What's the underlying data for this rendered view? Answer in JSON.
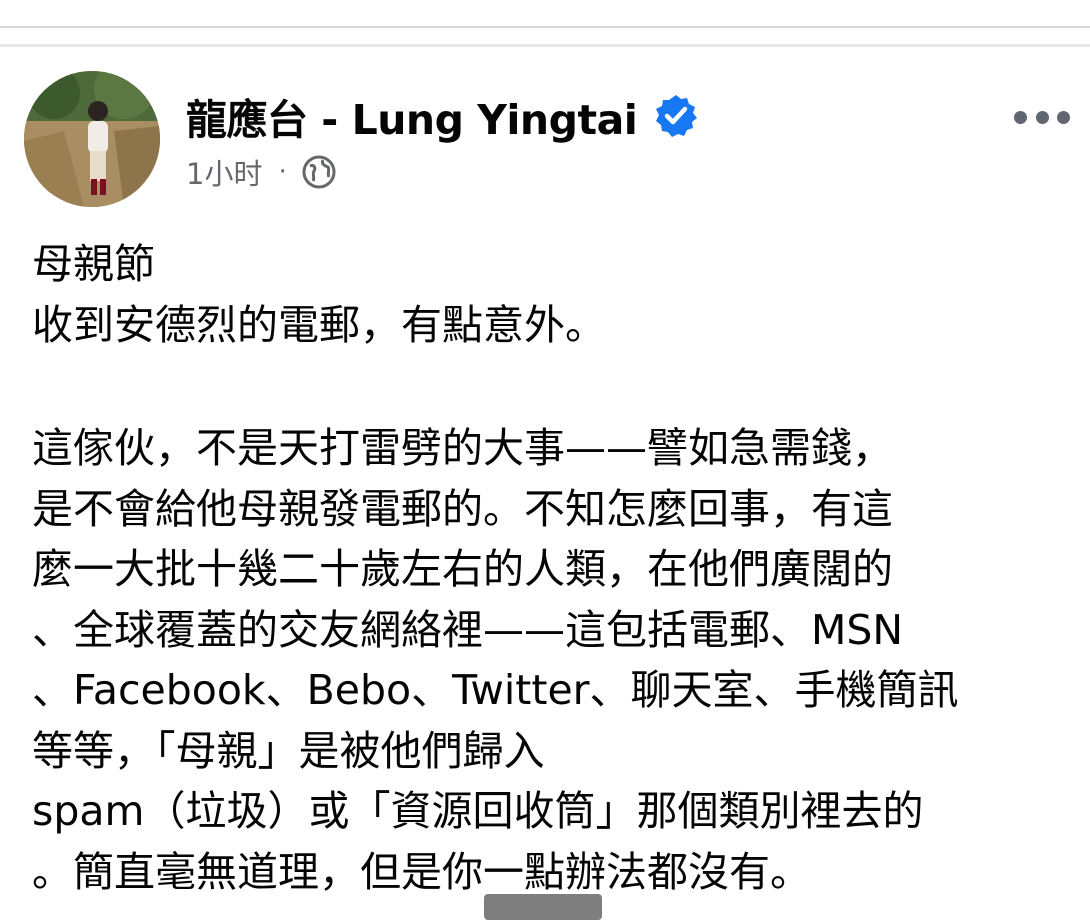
{
  "post": {
    "author_name": "龍應台 - Lung Yingtai",
    "timestamp": "1小时",
    "separator": "·",
    "body_lines": [
      "母親節",
      "收到安德烈的電郵，有點意外。",
      "",
      "這傢伙，不是天打雷劈的大事——譬如急需錢，",
      "是不會給他母親發電郵的。不知怎麼回事，有這",
      "麼一大批十幾二十歲左右的人類，在他們廣闊的",
      "、全球覆蓋的交友網絡裡——這包括電郵、MSN",
      "、Facebook、Bebo、Twitter、聊天室、手機簡訊",
      "等等，「母親」是被他們歸入",
      "spam（垃圾）或「資源回收筒」那個類別裡去的",
      "。簡直毫無道理，但是你一點辦法都沒有。"
    ]
  },
  "icons": {
    "verified": "verified-badge-icon",
    "audience": "globe-icon",
    "more": "more-options-icon"
  },
  "colors": {
    "verified_blue": "#1877f2",
    "text_primary": "#050505",
    "text_secondary": "#65676b"
  }
}
